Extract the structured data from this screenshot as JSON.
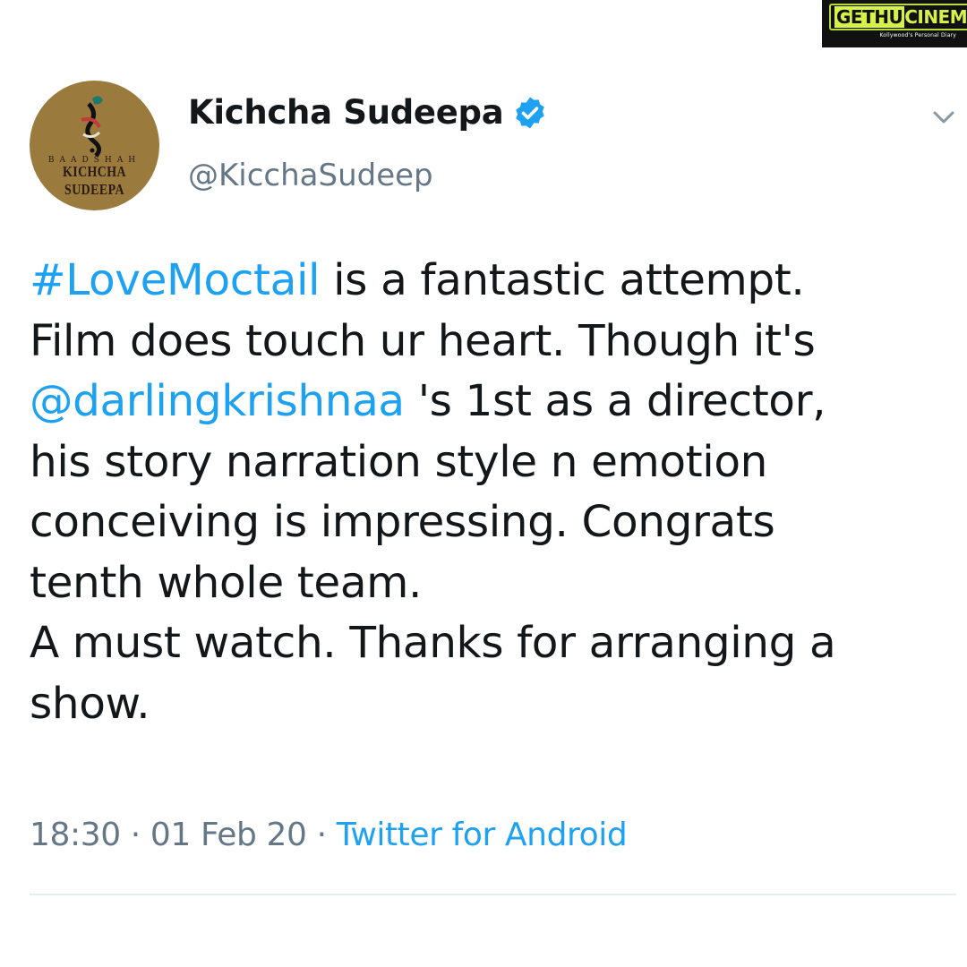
{
  "watermark": {
    "logo_left": "GETHU",
    "logo_right": "CINEMA",
    "tagline": "Kollywood's Personal Diary"
  },
  "profile": {
    "avatar_top_text": "BAADSHAH",
    "avatar_bottom_text": "KICHCHA SUDEEPA",
    "display_name": "Kichcha Sudeepa",
    "handle": "@KicchaSudeep",
    "verified": true
  },
  "tweet": {
    "lines": [
      {
        "link": "#LoveMoctail",
        "text": " is a fantastic attempt."
      },
      {
        "text": "Film does touch ur heart. Though it's"
      },
      {
        "link": "@darlingkrishnaa",
        "text": " 's 1st as a director,"
      },
      {
        "text": "his story narration style n emotion"
      },
      {
        "text": "conceiving is impressing. Congrats"
      },
      {
        "text": "tenth whole team."
      },
      {
        "text": "A must watch. Thanks for arranging a"
      },
      {
        "text": "show."
      }
    ]
  },
  "meta": {
    "time": "18:30",
    "separator": " · ",
    "date": "01 Feb 20",
    "source": "Twitter for Android"
  },
  "colors": {
    "link": "#1da1f2",
    "text": "#14171a",
    "secondary": "#657786",
    "avatar_bg": "#9a7a3d"
  },
  "icons": {
    "verified": "verified-badge-icon",
    "more": "chevron-down-icon"
  }
}
